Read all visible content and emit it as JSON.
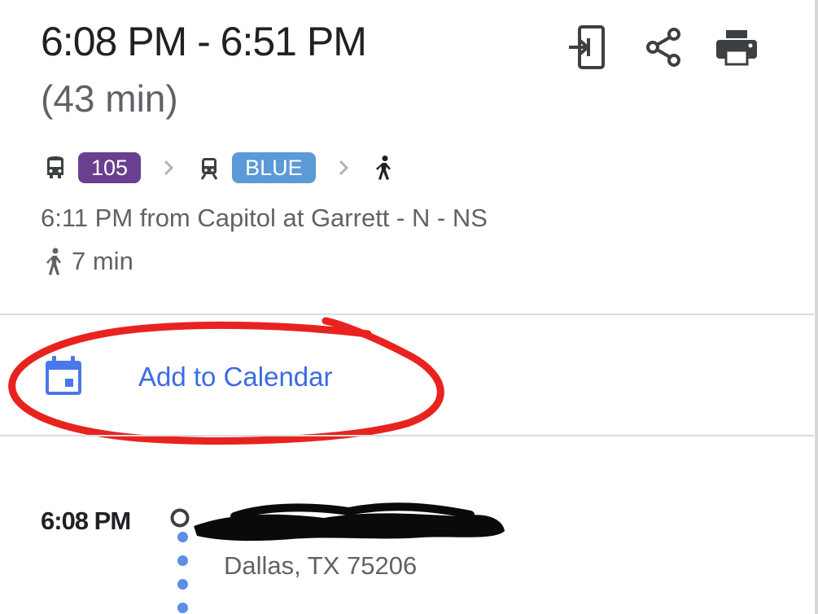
{
  "header": {
    "time_range": "6:08 PM - 6:51 PM",
    "duration": "(43 min)",
    "actions": [
      {
        "name": "send-to-phone-icon"
      },
      {
        "name": "share-icon"
      },
      {
        "name": "print-icon"
      }
    ]
  },
  "route": {
    "bus_icon": "bus-icon",
    "bus_line": "105",
    "bus_color": "#6b3f8f",
    "rail_icon": "tram-icon",
    "rail_line": "BLUE",
    "rail_color": "#5b9ad6",
    "walk_icon": "walk-icon"
  },
  "summary": {
    "departure": "6:11 PM from Capitol at Garrett - N - NS",
    "walk_time": "7 min"
  },
  "calendar": {
    "icon": "calendar-icon",
    "label": "Add to Calendar",
    "accent_color": "#3c6ce0"
  },
  "annotation": {
    "color": "#e8231f"
  },
  "steps": [
    {
      "time": "6:08 PM",
      "address": "Dallas, TX 75206"
    }
  ],
  "colors": {
    "primary_text": "#202124",
    "secondary_text": "#5f6368",
    "dot_color": "#5c8fe6",
    "divider": "#dadce0"
  }
}
